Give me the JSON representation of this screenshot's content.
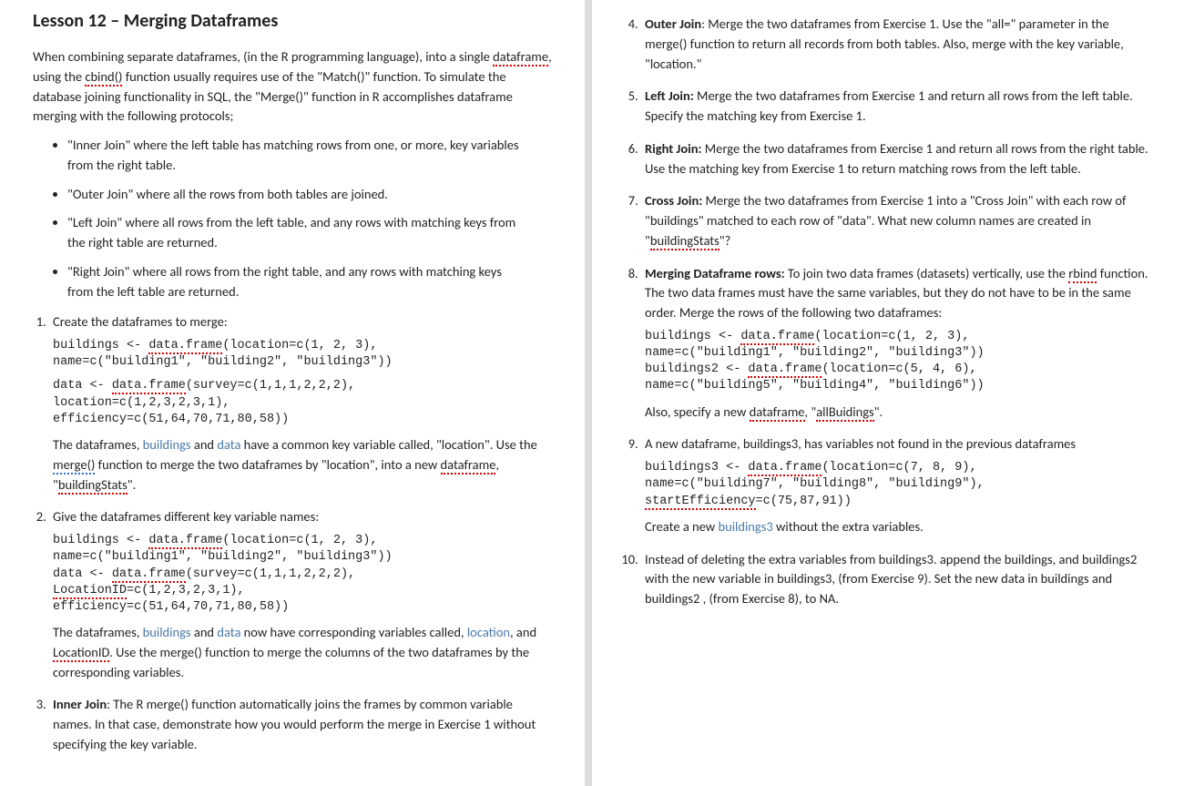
{
  "title": "Lesson 12 – Merging Dataframes",
  "intro": {
    "p1a": "When combining separate dataframes, (in the R programming language), into a single ",
    "p1_spell1": "dataframe",
    "p1b": ", using the ",
    "p1_spell2": "cbind()",
    "p1c": " function usually requires use of the \"Match()\" function. To simulate the database joining functionality in SQL, the \"Merge()\" function in R accomplishes dataframe merging with the following protocols;"
  },
  "bullets": [
    "\"Inner Join\" where the left table has matching rows from one, or more, key variables from the right table.",
    "\"Outer Join\" where all the rows from both tables are joined.",
    "\"Left Join\" where all rows from the left table, and any rows with matching keys from the right table are returned.",
    "\"Right Join\" where all rows from the right table, and any rows with matching keys from the left table are returned."
  ],
  "ex1": {
    "lead": "Create the dataframes to merge:",
    "code1a": "buildings <- ",
    "code1_sp": "data.frame",
    "code1b": "(location=c(1, 2, 3),\nname=c(\"building1\", \"building2\", \"building3\"))",
    "code2a": "data <- ",
    "code2_sp": "data.frame",
    "code2b": "(survey=c(1,1,1,2,2,2),\nlocation=c(1,2,3,2,3,1),\nefficiency=c(51,64,70,71,80,58))",
    "after_a": "The dataframes, ",
    "after_b": "buildings",
    "after_c": " and ",
    "after_d": "data",
    "after_e": " have a common key variable called, \"location\". Use the ",
    "after_merge": "merge()",
    "after_f": " function to merge the two dataframes by \"location\", into a new ",
    "after_df": "dataframe",
    "after_g": ", \"",
    "after_bs": "buildingStats",
    "after_h": "\"."
  },
  "ex2": {
    "lead": "Give the dataframes different key variable names:",
    "code1a": "buildings <- ",
    "code1_sp": "data.frame",
    "code1b": "(location=c(1, 2, 3),\nname=c(\"building1\", \"building2\", \"building3\"))\ndata <- ",
    "code1_sp2": "data.frame",
    "code1c": "(survey=c(1,1,1,2,2,2),\n",
    "code1_sp3": "LocationID",
    "code1d": "=c(1,2,3,2,3,1),\nefficiency=c(51,64,70,71,80,58))",
    "after_a": "The dataframes, ",
    "after_b": "buildings",
    "after_c": " and ",
    "after_d": "data",
    "after_e": " now have corresponding variables called, ",
    "after_loc": "location",
    "after_f": ", and ",
    "after_lid": "LocationID",
    "after_g": ". Use the merge() function to merge the columns of the two dataframes by the corresponding variables."
  },
  "ex3": {
    "bold": "Inner Join",
    "text": ": The R merge() function automatically joins the frames by common variable names. In that case, demonstrate how you would perform the merge in Exercise 1 without specifying the key variable."
  },
  "ex4": {
    "bold": "Outer Join",
    "text": ": Merge the two dataframes from Exercise 1. Use the \"all=\" parameter in the merge() function to return all records from both tables. Also, merge with the key variable, \"location.\""
  },
  "ex5": {
    "bold": "Left Join:",
    "text": " Merge the two dataframes from Exercise 1 and return all rows from the left table. Specify the matching key from Exercise 1."
  },
  "ex6": {
    "bold": "Right Join:",
    "text": " Merge the two dataframes from Exercise 1 and return all rows from the right table. Use the matching key from Exercise 1 to return matching rows from the left table."
  },
  "ex7": {
    "bold": "Cross Join:",
    "text_a": " Merge the two dataframes from Exercise 1 into a \"Cross Join\" with each row of \"buildings\" matched to each row of \"data\". What new column names are created in \"",
    "sp": "buildingStats",
    "text_b": "\"?"
  },
  "ex8": {
    "bold": "Merging Dataframe rows:",
    "text_a": " To join two data frames (datasets) vertically, use the ",
    "sp_rbind": "rbind",
    "text_b": " function. The two data frames must have the same variables, but they do not have to be in the same order. Merge the rows of the following two dataframes:",
    "code_a": "buildings <- ",
    "code_sp1": "data.frame",
    "code_b": "(location=c(1, 2, 3),\nname=c(\"building1\", \"building2\", \"building3\"))\nbuildings2 <- ",
    "code_sp2": "data.frame",
    "code_c": "(location=c(5, 4, 6),\nname=c(\"building5\", \"building4\", \"building6\"))",
    "after_a": "Also, specify a new ",
    "after_sp1": "dataframe",
    "after_b": ", \"",
    "after_sp2": "allBuidings",
    "after_c": "\"."
  },
  "ex9": {
    "lead": "A new dataframe, buildings3, has variables not found in the previous dataframes",
    "code_a": "buildings3 <- ",
    "code_sp1": "data.frame",
    "code_b": "(location=c(7, 8, 9),\nname=c(\"building7\", \"building8\", \"building9\"),\n",
    "code_sp2": "startEfficiency",
    "code_c": "=c(75,87,91))",
    "after_a": "Create a new ",
    "after_b": "buildings3",
    "after_c": " without the extra variables."
  },
  "ex10": {
    "text": "Instead of deleting the extra variables from buildings3. append the buildings, and buildings2 with the new variable in buildings3, (from Exercise 9). Set the new data in buildings and buildings2 , (from Exercise 8), to NA."
  }
}
